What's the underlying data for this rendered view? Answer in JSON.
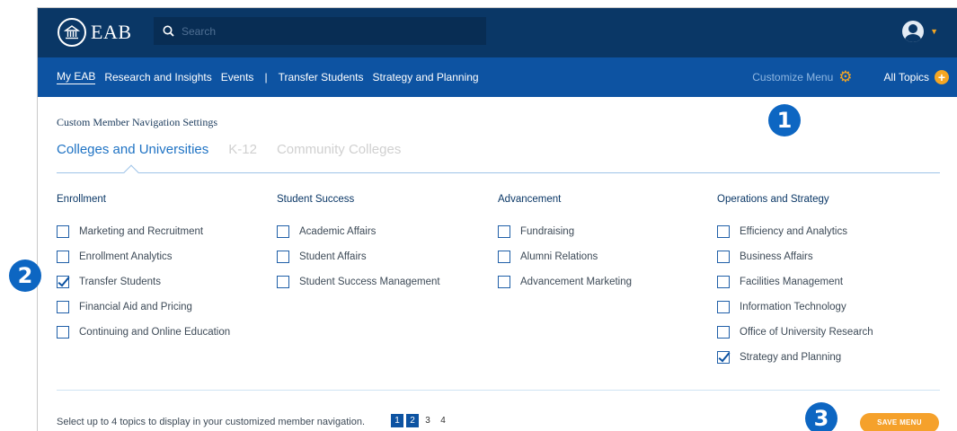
{
  "header": {
    "logo_text": "EAB",
    "search_placeholder": "Search"
  },
  "nav": {
    "links": [
      "My EAB",
      "Research and Insights",
      "Events"
    ],
    "separator": "|",
    "links2": [
      "Transfer Students",
      "Strategy and Planning"
    ],
    "customize_label": "Customize Menu",
    "all_topics_label": "All Topics"
  },
  "settings": {
    "title": "Custom Member Navigation Settings",
    "tabs": [
      "Colleges and Universities",
      "K-12",
      "Community Colleges"
    ]
  },
  "columns": [
    {
      "title": "Enrollment",
      "options": [
        {
          "label": "Marketing and Recruitment",
          "checked": false
        },
        {
          "label": "Enrollment Analytics",
          "checked": false
        },
        {
          "label": "Transfer Students",
          "checked": true
        },
        {
          "label": "Financial Aid and Pricing",
          "checked": false
        },
        {
          "label": "Continuing and Online Education",
          "checked": false
        }
      ]
    },
    {
      "title": "Student Success",
      "options": [
        {
          "label": "Academic Affairs",
          "checked": false
        },
        {
          "label": "Student Affairs",
          "checked": false
        },
        {
          "label": "Student Success Management",
          "checked": false
        }
      ]
    },
    {
      "title": "Advancement",
      "options": [
        {
          "label": "Fundraising",
          "checked": false
        },
        {
          "label": "Alumni Relations",
          "checked": false
        },
        {
          "label": "Advancement Marketing",
          "checked": false
        }
      ]
    },
    {
      "title": "Operations and Strategy",
      "options": [
        {
          "label": "Efficiency and Analytics",
          "checked": false
        },
        {
          "label": "Business Affairs",
          "checked": false
        },
        {
          "label": "Facilities Management",
          "checked": false
        },
        {
          "label": "Information Technology",
          "checked": false
        },
        {
          "label": "Office of University Research",
          "checked": false
        },
        {
          "label": "Strategy and Planning",
          "checked": true
        }
      ]
    }
  ],
  "footer": {
    "instruction": "Select up to 4 topics to display in your customized member navigation.",
    "pages": [
      "1",
      "2",
      "3",
      "4"
    ],
    "selected_pages": [
      "1",
      "2"
    ],
    "save_label": "SAVE MENU"
  },
  "markers": [
    "1",
    "2",
    "3"
  ],
  "colors": {
    "header_bg": "#0a3766",
    "nav_bg": "#0d53a2",
    "accent_orange": "#f5a623",
    "marker_blue": "#0d66c2"
  }
}
